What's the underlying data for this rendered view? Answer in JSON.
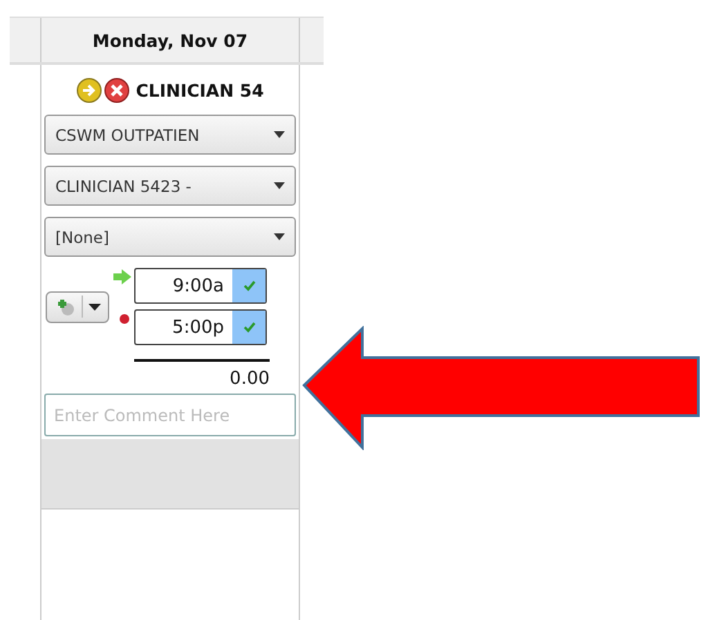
{
  "header": {
    "date": "Monday, Nov 07"
  },
  "entry": {
    "name": "CLINICIAN 54",
    "dropdowns": [
      {
        "value": "CSWM OUTPATIEN"
      },
      {
        "value": "CLINICIAN 5423 -"
      },
      {
        "value": "[None]"
      }
    ],
    "times": [
      {
        "kind": "in",
        "value": "9:00a",
        "confirmed": true
      },
      {
        "kind": "out",
        "value": "5:00p",
        "confirmed": true
      }
    ],
    "total": "0.00",
    "comment": {
      "placeholder": "Enter Comment Here"
    }
  }
}
